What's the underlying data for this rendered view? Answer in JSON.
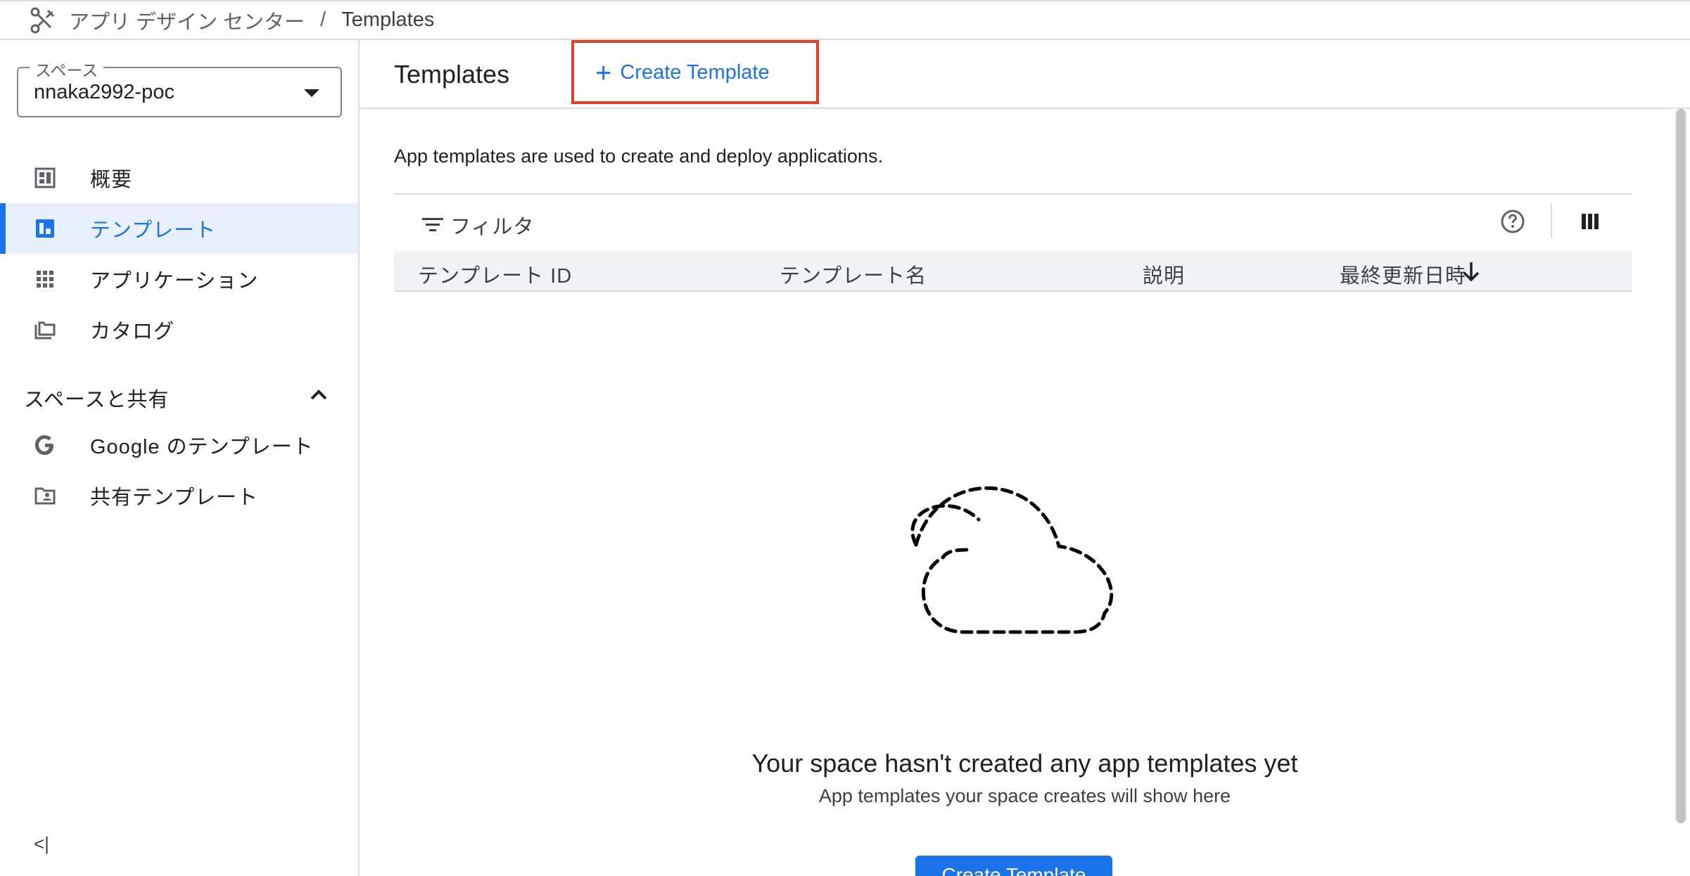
{
  "breadcrumb": {
    "app_name": "アプリ デザイン センター",
    "separator": "/",
    "current": "Templates"
  },
  "sidebar": {
    "space_label": "スペース",
    "space_value": "nnaka2992-poc",
    "items": [
      {
        "label": "概要",
        "icon": "dashboard-icon",
        "active": false
      },
      {
        "label": "テンプレート",
        "icon": "template-icon",
        "active": true
      },
      {
        "label": "アプリケーション",
        "icon": "apps-grid-icon",
        "active": false
      },
      {
        "label": "カタログ",
        "icon": "catalog-icon",
        "active": false
      }
    ],
    "section_title": "スペースと共有",
    "section_items": [
      {
        "label": "Google のテンプレート",
        "icon": "google-icon"
      },
      {
        "label": "共有テンプレート",
        "icon": "shared-folder-icon"
      }
    ],
    "collapse_label": "<|"
  },
  "main": {
    "title": "Templates",
    "create_link_label": "Create Template",
    "description": "App templates are used to create and deploy applications.",
    "filter_label": "フィルタ",
    "columns": [
      "テンプレート ID",
      "テンプレート名",
      "説明",
      "最終更新日時"
    ],
    "empty_title": "Your space hasn't created any app templates yet",
    "empty_subtitle": "App templates your space creates will show here",
    "create_button_label": "Create Template"
  },
  "colors": {
    "accent": "#1a73e8",
    "highlight_box": "#e1412c",
    "active_nav_bg": "#e8f0fe"
  }
}
